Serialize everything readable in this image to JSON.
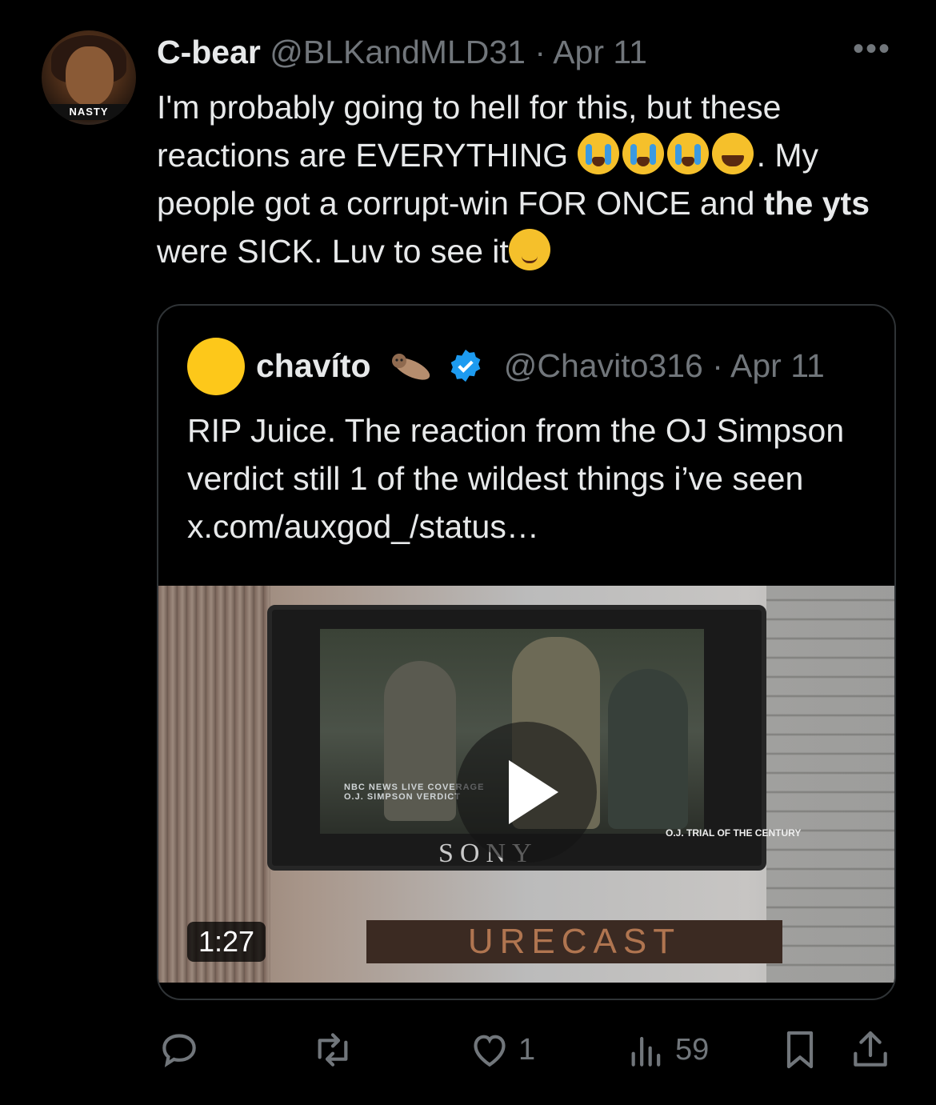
{
  "tweet": {
    "author_name": "C-bear",
    "author_handle": "@BLKandMLD31",
    "separator": "·",
    "date": "Apr 11",
    "avatar_banner": "NASTY",
    "text_parts": {
      "p1": "I'm probably going to hell for this, but these reactions are EVERYTHING",
      "p2": ". My people got a corrupt-win FOR ONCE and ",
      "bold": "the yts",
      "p3": " were SICK. Luv to see it"
    },
    "more_icon": "•••"
  },
  "quote": {
    "author_name": "chavíto",
    "author_handle": "@Chavito316",
    "separator": "·",
    "date": "Apr 11",
    "text": "RIP Juice. The reaction from the OJ Simpson verdict still 1 of the wildest things i’ve seen  x.com/auxgod_/status…",
    "video": {
      "duration": "1:27",
      "tv_brand": "SONY",
      "chyron_1": "NBC NEWS  LIVE COVERAGE",
      "chyron_2": "O.J. SIMPSON VERDICT",
      "trial_text": "O.J. TRIAL OF THE CENTURY",
      "ticker": "URECAST"
    }
  },
  "actions": {
    "replies": "",
    "retweets": "",
    "likes": "1",
    "views": "59"
  },
  "colors": {
    "background": "#000000",
    "text": "#e7e9ea",
    "muted": "#71767b",
    "verified": "#1d9bf0",
    "quote_avatar": "#fdc81a"
  }
}
